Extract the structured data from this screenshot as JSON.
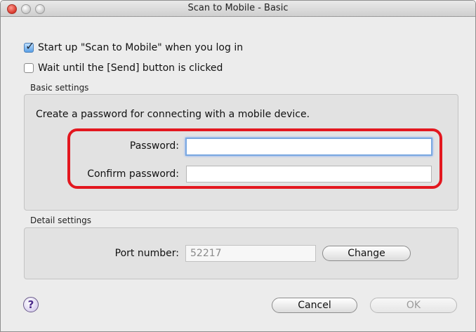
{
  "window": {
    "title": "Scan to Mobile - Basic"
  },
  "options": {
    "startup_label": "Start up \"Scan to Mobile\" when you log in",
    "startup_checked": true,
    "wait_label": "Wait until the [Send] button is clicked",
    "wait_checked": false
  },
  "basic_settings": {
    "section_label": "Basic settings",
    "description": "Create a password for connecting with a mobile device.",
    "password_label": "Password:",
    "password_value": "",
    "confirm_label": "Confirm password:",
    "confirm_value": ""
  },
  "detail_settings": {
    "section_label": "Detail settings",
    "port_label": "Port number:",
    "port_value": "52217",
    "change_label": "Change"
  },
  "footer": {
    "help_glyph": "?",
    "cancel_label": "Cancel",
    "ok_label": "OK"
  },
  "colors": {
    "highlight": "#e3171f",
    "focus_ring": "#7aa8e0"
  },
  "icons": {
    "help": "help-icon",
    "checkmark": "checkmark-icon"
  }
}
